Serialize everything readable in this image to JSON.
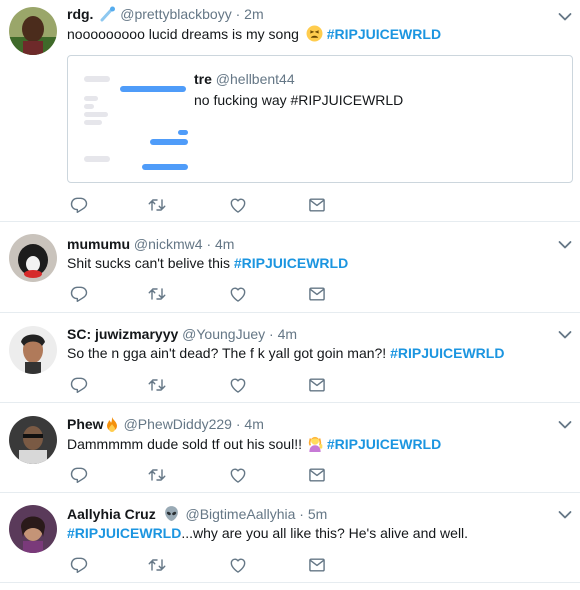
{
  "tweets": [
    {
      "name": "rdg.",
      "name_emoji": "comet-emoji",
      "handle": "@prettyblackboyy",
      "time": "· 2m",
      "text": "nooooooooo lucid dreams is my song ",
      "text_emoji": "tired-face-emoji",
      "hashtag": "#RIPJUICEWRLD",
      "quote": {
        "name": "tre",
        "handle": "@hellbent44",
        "text": "no fucking way #RIPJUICEWRLD"
      }
    },
    {
      "name": "mumumu",
      "handle": "@nickmw4",
      "time": "· 4m",
      "text": "Shit sucks can't belive this ",
      "hashtag": "#RIPJUICEWRLD"
    },
    {
      "name": "SC: juwizmaryyy",
      "handle": "@YoungJuey",
      "time": "· 4m",
      "text": "So the n  gga ain't dead? The f  k yall got goin man?! ",
      "hashtag": "#RIPJUICEWRLD"
    },
    {
      "name": "Phew",
      "name_emoji": "fire-emoji",
      "handle": "@PhewDiddy229",
      "time": "· 4m",
      "text": "Dammmmm dude sold tf out his soul!!  ",
      "text_emoji": "person-gesturing-emoji",
      "hashtag": "#RIPJUICEWRLD"
    },
    {
      "name": "Aallyhia Cruz",
      "name_emoji": "alien-emoji",
      "handle": "@BigtimeAallyhia",
      "time": "· 5m",
      "hashtag": "#RIPJUICEWRLD",
      "text_after": "...why are you all like this? He's alive and well."
    }
  ],
  "colors": {
    "link": "#1b95e0",
    "text": "#14171a",
    "muted": "#657786",
    "divider": "#e6ecf0"
  }
}
